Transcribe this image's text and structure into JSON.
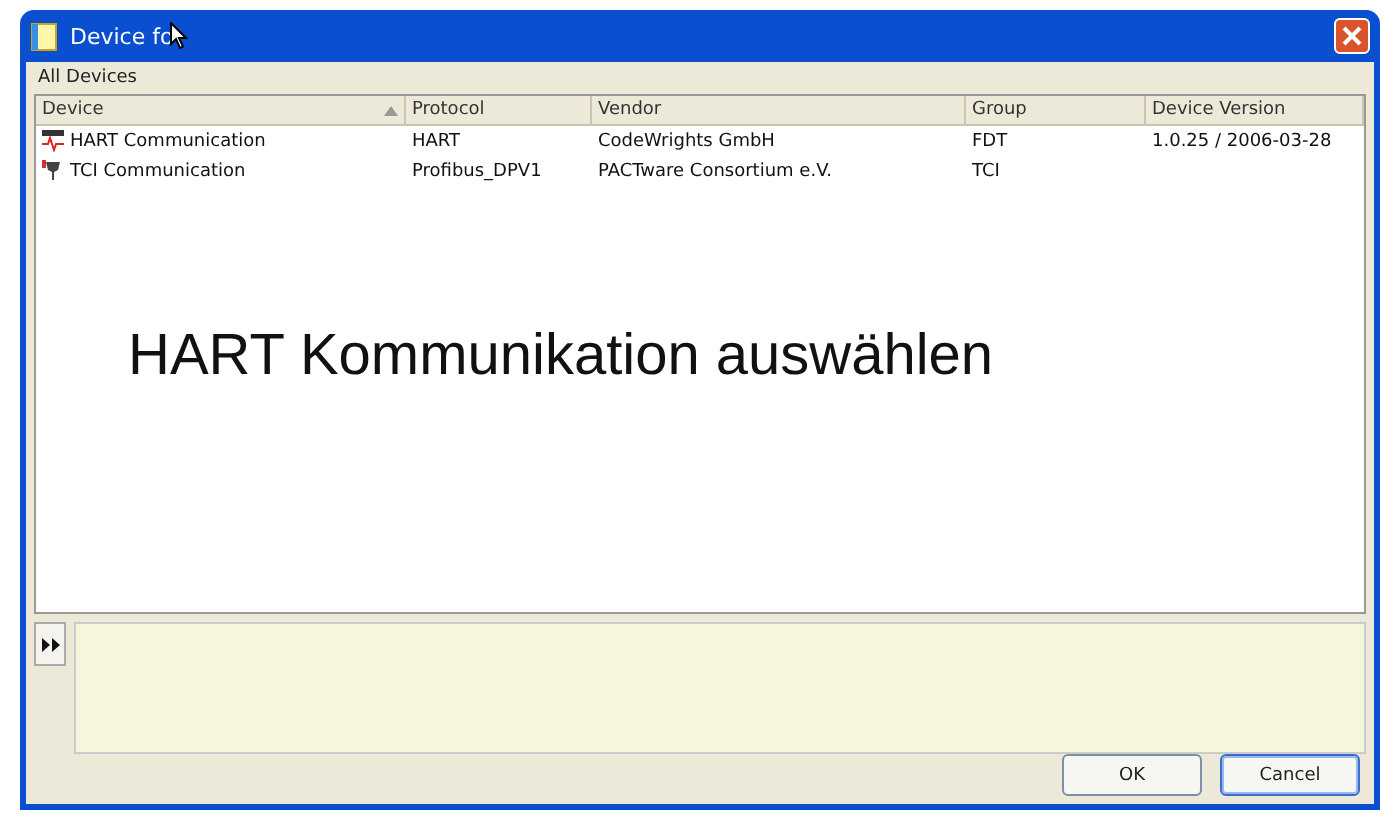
{
  "window": {
    "title": "Device fo"
  },
  "section_label": "All Devices",
  "table": {
    "columns": [
      {
        "label": "Device",
        "sorted": true
      },
      {
        "label": "Protocol",
        "sorted": false
      },
      {
        "label": "Vendor",
        "sorted": false
      },
      {
        "label": "Group",
        "sorted": false
      },
      {
        "label": "Device Version",
        "sorted": false
      }
    ],
    "rows": [
      {
        "kind": "hart",
        "cells": [
          "HART Communication",
          "HART",
          "CodeWrights GmbH",
          "FDT",
          "1.0.25 / 2006-03-28"
        ]
      },
      {
        "kind": "tci",
        "cells": [
          "TCI Communication",
          "Profibus_DPV1",
          "PACTware Consortium e.V.",
          "TCI",
          ""
        ]
      }
    ]
  },
  "annotation": "HART Kommunikation auswählen",
  "buttons": [
    {
      "label": "OK",
      "focused": false
    },
    {
      "label": "Cancel",
      "focused": true
    }
  ]
}
